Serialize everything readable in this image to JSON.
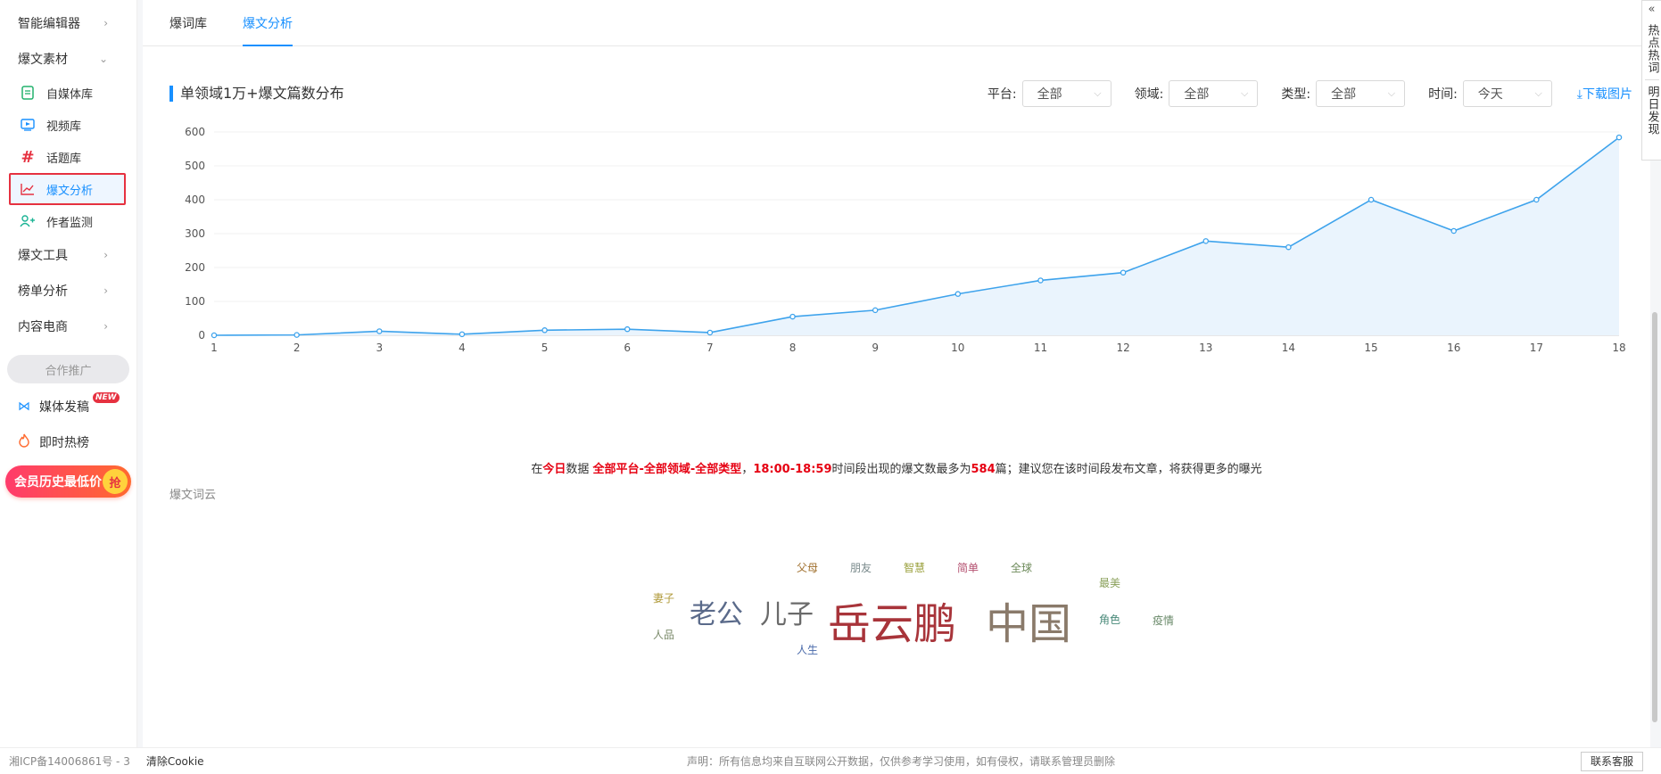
{
  "sidebar": {
    "groups_top": [
      {
        "label": "智能编辑器",
        "chevron": ">"
      },
      {
        "label": "爆文素材",
        "chevron": "v"
      }
    ],
    "items": [
      {
        "label": "自媒体库",
        "icon": "document-icon"
      },
      {
        "label": "视频库",
        "icon": "video-icon"
      },
      {
        "label": "话题库",
        "icon": "hashtag-icon"
      },
      {
        "label": "爆文分析",
        "icon": "line-chart-icon"
      },
      {
        "label": "作者监测",
        "icon": "add-user-icon"
      }
    ],
    "groups_bottom": [
      {
        "label": "爆文工具"
      },
      {
        "label": "榜单分析"
      },
      {
        "label": "内容电商"
      }
    ],
    "promo_label": "合作推广",
    "media_label": "媒体发稿",
    "new_badge": "NEW",
    "hot_label": "即时热榜",
    "vip_label": "会员历史最低价",
    "vip_grab": "抢"
  },
  "tabs": [
    {
      "label": "爆词库"
    },
    {
      "label": "爆文分析"
    }
  ],
  "section": {
    "title": "单领域1万+爆文篇数分布",
    "filters": [
      {
        "label": "平台:",
        "value": "全部"
      },
      {
        "label": "领域:",
        "value": "全部"
      },
      {
        "label": "类型:",
        "value": "全部"
      },
      {
        "label": "时间:",
        "value": "今天"
      }
    ],
    "download_label": "⤓下载图片"
  },
  "chart_data": {
    "type": "area",
    "x": [
      1,
      2,
      3,
      4,
      5,
      6,
      7,
      8,
      9,
      10,
      11,
      12,
      13,
      14,
      15,
      16,
      17,
      18
    ],
    "values": [
      0,
      1,
      12,
      3,
      15,
      18,
      8,
      55,
      74,
      122,
      162,
      185,
      278,
      260,
      400,
      308,
      400,
      584
    ],
    "ylim": [
      0,
      600
    ],
    "yticks": [
      0,
      100,
      200,
      300,
      400,
      500,
      600
    ],
    "grid": true,
    "line_color": "#3ea3ec",
    "fill_color": "#eaf4fd"
  },
  "summary": {
    "p1": "在",
    "today": "今日",
    "p2": "数据 ",
    "scope": "全部平台-全部领域-全部类型",
    "p3": "，",
    "time": "18:00-18:59",
    "p4": "时间段出现的爆文数最多为",
    "count": "584",
    "p5": "篇；建议您在该时间段发布文章，将获得更多的曝光"
  },
  "cloud_title": "爆文词云",
  "word_cloud": [
    {
      "text": "父母",
      "color": "#a0702e"
    },
    {
      "text": "朋友",
      "color": "#7a8a8c"
    },
    {
      "text": "智慧",
      "color": "#9aa03c"
    },
    {
      "text": "简单",
      "color": "#b34e6e"
    },
    {
      "text": "全球",
      "color": "#6d8a5a"
    },
    {
      "text": "最美",
      "color": "#8aa05a"
    },
    {
      "text": "妻子",
      "color": "#b09a3a"
    },
    {
      "text": "老公",
      "color": "#5a6a8a"
    },
    {
      "text": "儿子",
      "color": "#6a6a6a"
    },
    {
      "text": "岳云鹏",
      "color": "#a8343a"
    },
    {
      "text": "中国",
      "color": "#8a7a6a"
    },
    {
      "text": "角色",
      "color": "#4a8a7a"
    },
    {
      "text": "疫情",
      "color": "#6a8a6a"
    },
    {
      "text": "人品",
      "color": "#7a8a6a"
    },
    {
      "text": "人生",
      "color": "#4a6aaa"
    }
  ],
  "footer": {
    "icp": "湘ICP备14006861号 - 3",
    "cookie": "清除Cookie",
    "notice": "声明：所有信息均来自互联网公开数据，仅供参考学习使用，如有侵权，请联系管理员删除",
    "contact": "联系客服"
  },
  "float_panel": {
    "collapse": "«",
    "hot_words": "热点热词",
    "tomorrow": "明日发现"
  }
}
